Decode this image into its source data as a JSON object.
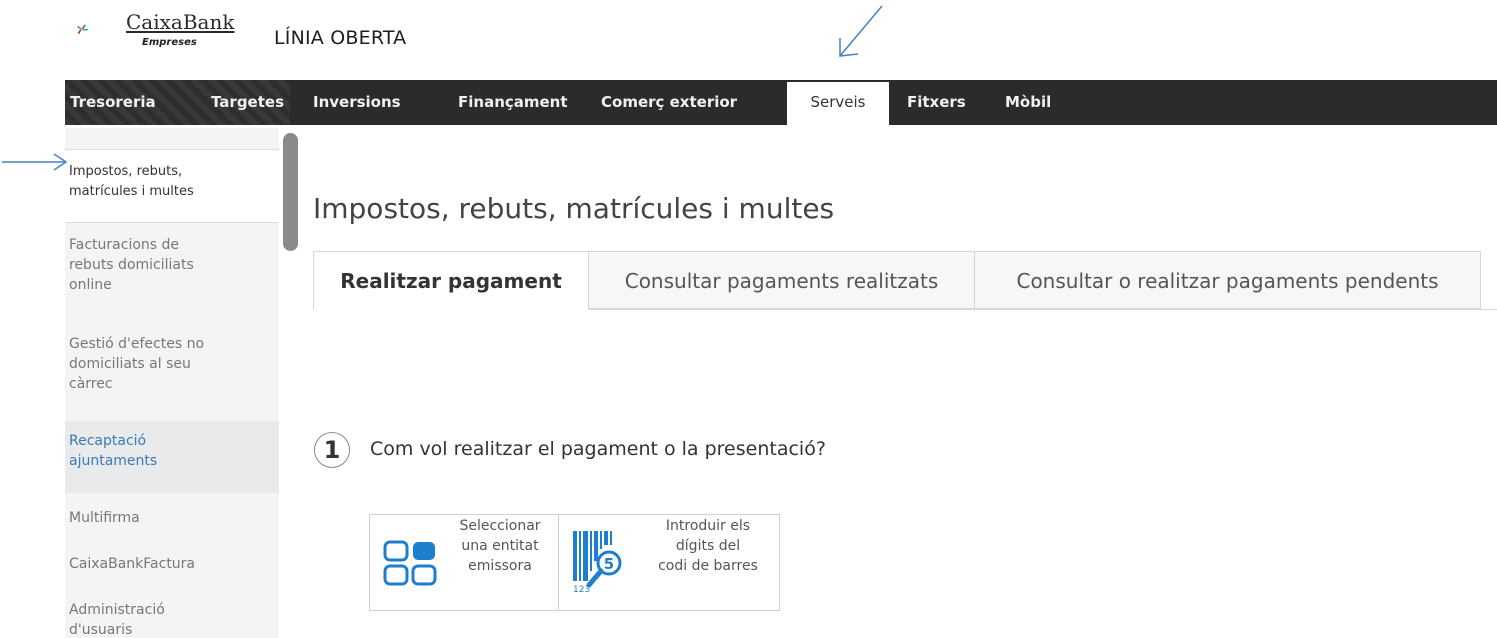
{
  "header": {
    "brand_name": "CaixaBank",
    "brand_sub": "Empreses",
    "app_title": "LÍNIA OBERTA"
  },
  "nav": {
    "items": [
      "Tresoreria",
      "Targetes",
      "Inversions",
      "Finançament",
      "Comerç exterior",
      "Serveis",
      "Fitxers",
      "Mòbil"
    ],
    "active": "Serveis"
  },
  "sidebar": {
    "items": [
      {
        "label": "Impostos, rebuts, matrícules i multes",
        "lines": [
          "Impostos, rebuts,",
          "matrícules i multes"
        ]
      },
      {
        "label": "Facturacions de rebuts domiciliats online",
        "lines": [
          "Facturacions de",
          "rebuts domiciliats",
          "online"
        ]
      },
      {
        "label": "Gestió d'efectes no domiciliats al seu càrrec",
        "lines": [
          "Gestió d'efectes no",
          "domiciliats al seu",
          "càrrec"
        ]
      },
      {
        "label": "Recaptació ajuntaments",
        "lines": [
          "Recaptació",
          "ajuntaments"
        ]
      },
      {
        "label": "Multifirma",
        "lines": [
          "Multifirma"
        ]
      },
      {
        "label": "CaixaBankFactura",
        "lines": [
          "CaixaBankFactura"
        ]
      },
      {
        "label": "Administració d'usuaris",
        "lines": [
          "Administració",
          "d'usuaris"
        ]
      }
    ]
  },
  "main": {
    "title": "Impostos, rebuts, matrícules i multes",
    "tabs": [
      "Realitzar pagament",
      "Consultar pagaments realitzats",
      "Consultar o realitzar pagaments pendents"
    ],
    "active_tab": "Realitzar pagament",
    "step": {
      "number": "1",
      "question": "Com vol realitzar el pagament o la presentació?"
    },
    "options": [
      {
        "icon": "entity-grid-icon",
        "lines": [
          "Seleccionar",
          "una entitat",
          "emissora"
        ]
      },
      {
        "icon": "barcode-search-icon",
        "lines": [
          "Introduir els",
          "dígits del",
          "codi de barres"
        ],
        "icon_text": [
          "123",
          "5"
        ]
      }
    ]
  },
  "colors": {
    "nav_bg": "#2b2b2b",
    "brand_blue": "#0a7cc1",
    "brand_orange": "#f7a81b",
    "link_blue": "#3b7ab8",
    "option_icon_blue": "#1f7fcf",
    "annotation_arrow": "#4a7fc0"
  }
}
